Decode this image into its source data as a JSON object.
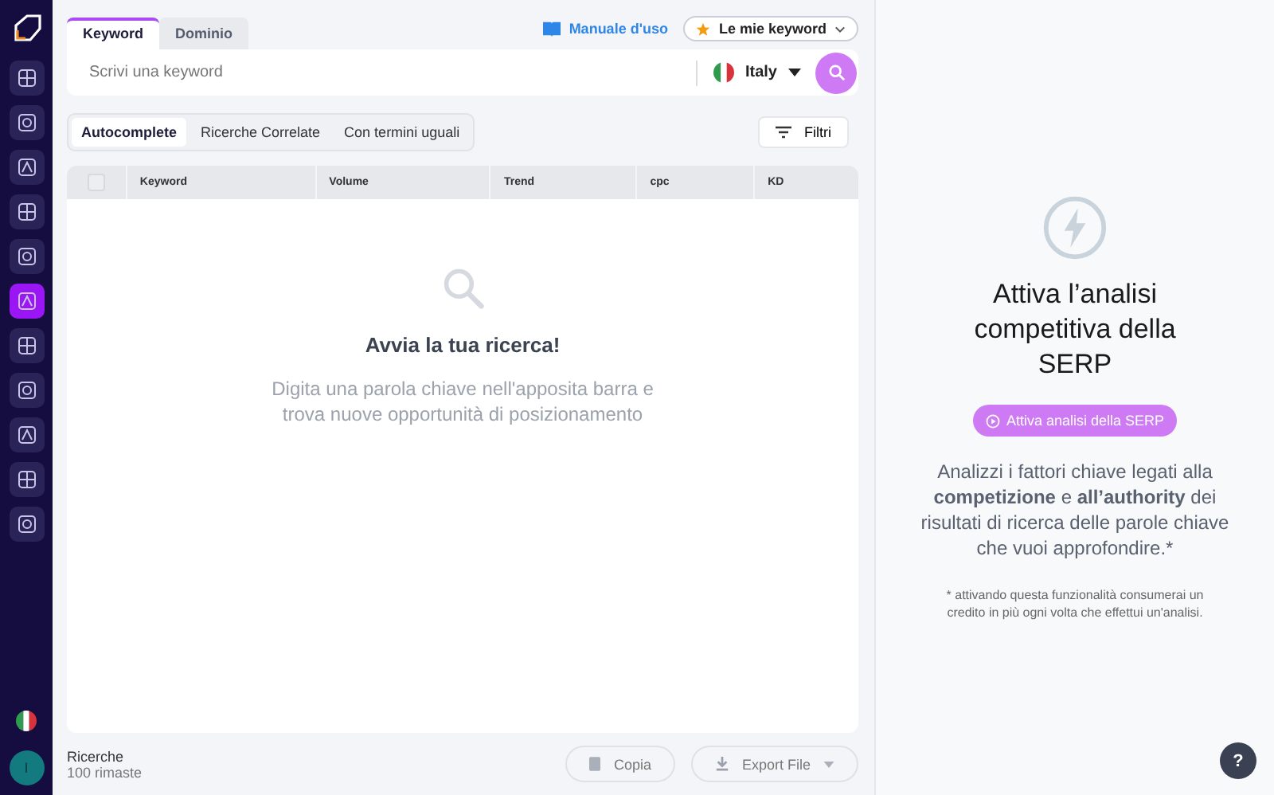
{
  "sidebar": {
    "items": [
      {
        "selected": false
      },
      {
        "selected": false
      },
      {
        "selected": false
      },
      {
        "selected": false
      },
      {
        "selected": false
      },
      {
        "selected": true
      },
      {
        "selected": false
      },
      {
        "selected": false
      },
      {
        "selected": false
      },
      {
        "selected": false
      },
      {
        "selected": false
      }
    ],
    "avatar": "I"
  },
  "tabs": [
    {
      "label": "Keyword",
      "selected": true
    },
    {
      "label": "Dominio",
      "selected": false
    }
  ],
  "manual_link": "Manuale d'uso",
  "my_keywords": "Le mie keyword",
  "search": {
    "placeholder": "Scrivi una keyword"
  },
  "country": "Italy",
  "modes": [
    {
      "label": "Autocomplete",
      "selected": true
    },
    {
      "label": "Ricerche Correlate",
      "selected": false
    },
    {
      "label": "Con termini uguali",
      "selected": false
    }
  ],
  "filters": "Filtri",
  "table": {
    "select_all_checked": false,
    "columns": [
      "Keyword",
      "Volume",
      "Trend",
      "cpc",
      "KD"
    ]
  },
  "empty": {
    "title": "Avvia la tua ricerca!",
    "text": "Digita una parola chiave nell'apposita barra e trova nuove opportunità di posizionamento"
  },
  "footer": {
    "label": "Ricerche",
    "remaining": "100 rimaste",
    "copy": "Copia",
    "export": "Export File"
  },
  "serp": {
    "title": "Attiva l’analisi competitiva della SERP",
    "button": "Attiva analisi della SERP",
    "text": "Analizzi i fattori chiave legati alla **competizione** e **all’authority** dei risultati di ricerca delle parole chiave che vuoi approfondire.*",
    "note": "* attivando questa funzionalità consumerai un credito in più ogni volta che effettui un'analisi."
  },
  "help": "?"
}
